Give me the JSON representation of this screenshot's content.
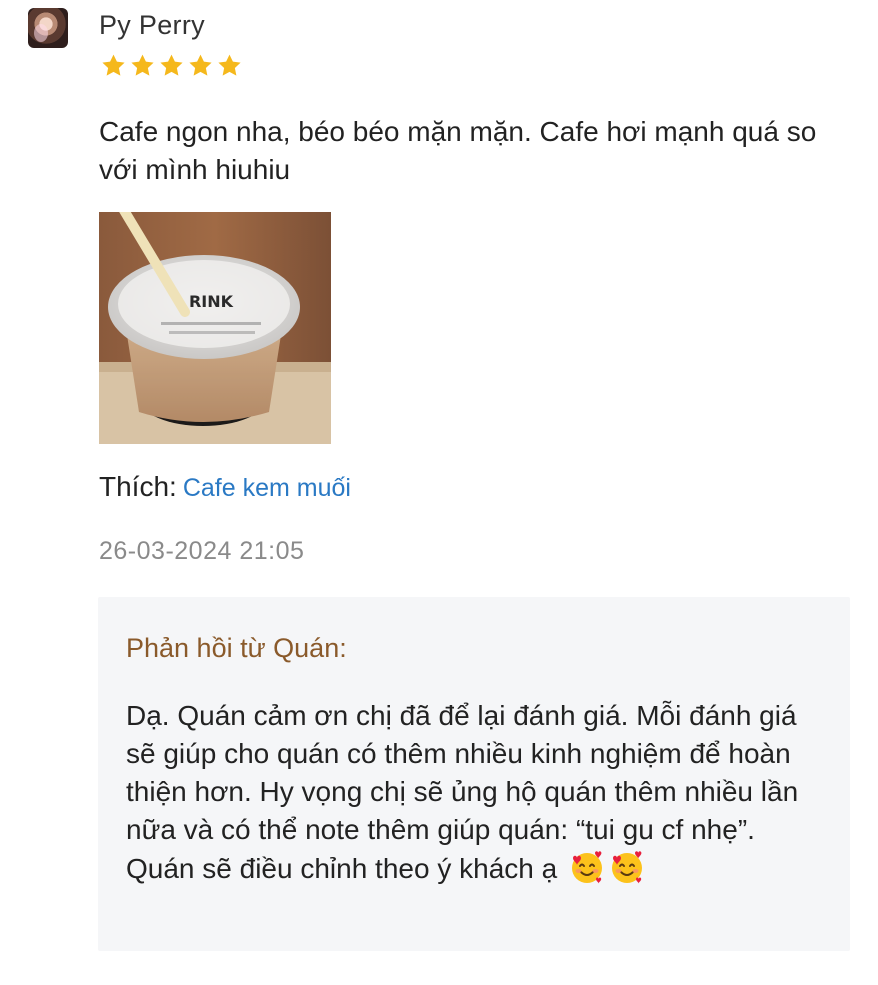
{
  "review": {
    "user_name": "Py Perry",
    "rating": 5,
    "rating_max": 5,
    "comment": "Cafe ngon nha, béo béo mặn mặn. Cafe hơi mạnh quá so với mình hiuhiu",
    "photo_cup_logo": "RINK",
    "liked_label": "Thích:",
    "liked_dish": "Cafe kem muối",
    "timestamp": "26-03-2024 21:05"
  },
  "reply": {
    "title": "Phản hồi từ Quán:",
    "text": "Dạ. Quán cảm ơn chị đã để lại đánh giá. Mỗi đánh giá sẽ giúp cho quán có thêm nhiều kinh nghiệm để hoàn thiện hơn. Hy vọng chị sẽ ủng hộ quán thêm nhiều lần nữa và có thể note thêm giúp quán: “tui gu cf nhẹ”. Quán sẽ điều chỉnh theo ý khách ạ",
    "emojis": [
      "smiling-face-with-hearts-icon",
      "smiling-face-with-hearts-icon"
    ]
  },
  "colors": {
    "star": "#f5b81c",
    "link": "#2a79c4",
    "reply_title": "#8a5a2b",
    "reply_bg": "#f5f6f8",
    "timestamp": "#8a8a8a"
  }
}
